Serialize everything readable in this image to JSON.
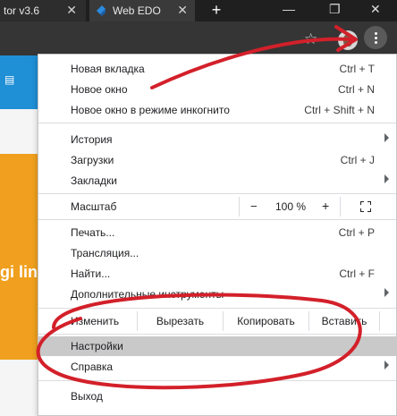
{
  "tabs": [
    {
      "title": "tor v3.6"
    },
    {
      "title": "Web EDO"
    }
  ],
  "new_tab": "+",
  "window_controls": {
    "minimize": "—",
    "restore": "❐",
    "close": "✕"
  },
  "page_behind": {
    "link_text": "gi link"
  },
  "menu": {
    "new_tab": {
      "label": "Новая вкладка",
      "shortcut": "Ctrl + T"
    },
    "new_window": {
      "label": "Новое окно",
      "shortcut": "Ctrl + N"
    },
    "incognito": {
      "label": "Новое окно в режиме инкогнито",
      "shortcut": "Ctrl + Shift + N"
    },
    "history": {
      "label": "История"
    },
    "downloads": {
      "label": "Загрузки",
      "shortcut": "Ctrl + J"
    },
    "bookmarks": {
      "label": "Закладки"
    },
    "zoom": {
      "label": "Масштаб",
      "minus": "−",
      "value": "100 %",
      "plus": "+"
    },
    "print": {
      "label": "Печать...",
      "shortcut": "Ctrl + P"
    },
    "cast": {
      "label": "Трансляция..."
    },
    "find": {
      "label": "Найти...",
      "shortcut": "Ctrl + F"
    },
    "more_tools": {
      "label": "Дополнительные инструменты"
    },
    "edit": {
      "label": "Изменить",
      "cut": "Вырезать",
      "copy": "Копировать",
      "paste": "Вставить"
    },
    "settings": {
      "label": "Настройки"
    },
    "help": {
      "label": "Справка"
    },
    "exit": {
      "label": "Выход"
    }
  },
  "colors": {
    "annotation": "#d3202a",
    "highlight": "#c9c9c9",
    "tabstrip": "#1f1f1f",
    "toolbar": "#353535",
    "page_blue": "#1f8fd6",
    "page_orange": "#f0a01e"
  }
}
